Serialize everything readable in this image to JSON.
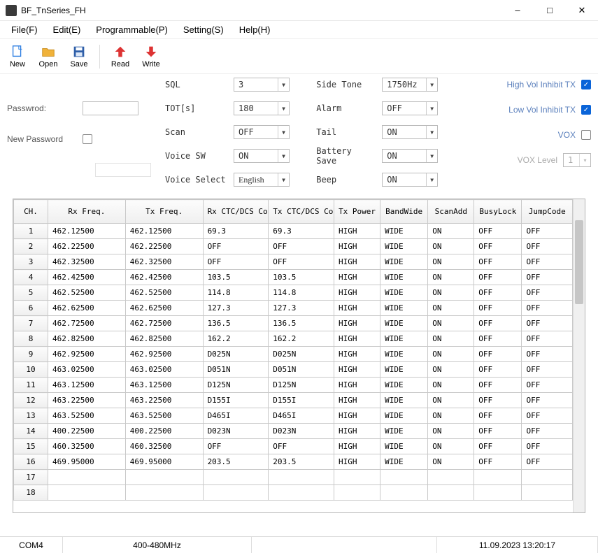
{
  "window": {
    "title": "BF_TnSeries_FH"
  },
  "menu": {
    "file": "File(F)",
    "edit": "Edit(E)",
    "programmable": "Programmable(P)",
    "setting": "Setting(S)",
    "help": "Help(H)"
  },
  "toolbar": {
    "new": "New",
    "open": "Open",
    "save": "Save",
    "read": "Read",
    "write": "Write"
  },
  "password": {
    "label_current": "Passwrod:",
    "label_new": "New Password",
    "value_current": "",
    "value_new": "",
    "new_checked": false
  },
  "settings_a": {
    "sql": {
      "label": "SQL",
      "value": "3"
    },
    "tot": {
      "label": "TOT[s]",
      "value": "180"
    },
    "scan": {
      "label": "Scan",
      "value": "OFF"
    },
    "voice_sw": {
      "label": "Voice SW",
      "value": "ON"
    },
    "voice_select": {
      "label": "Voice Select",
      "value": "English"
    }
  },
  "settings_b": {
    "side_tone": {
      "label": "Side Tone",
      "value": "1750Hz"
    },
    "alarm": {
      "label": "Alarm",
      "value": "OFF"
    },
    "tail": {
      "label": "Tail",
      "value": "ON"
    },
    "battery_save": {
      "label": "Battery Save",
      "value": "ON"
    },
    "beep": {
      "label": "Beep",
      "value": "ON"
    }
  },
  "settings_c": {
    "high_vol": {
      "label": "High Vol Inhibit TX",
      "checked": true
    },
    "low_vol": {
      "label": "Low Vol Inhibit TX",
      "checked": true
    },
    "vox": {
      "label": "VOX",
      "checked": false
    },
    "vox_level": {
      "label": "VOX Level",
      "value": "1"
    }
  },
  "table": {
    "headers": {
      "ch": "CH.",
      "rx_freq": "Rx Freq.",
      "tx_freq": "Tx Freq.",
      "rx_code": "Rx CTC/DCS Code",
      "tx_code": "Tx CTC/DCS Code",
      "tx_power": "Tx Power",
      "bandwide": "BandWide",
      "scanadd": "ScanAdd",
      "busylock": "BusyLock",
      "jumpcode": "JumpCode"
    },
    "rows": [
      {
        "ch": "1",
        "rx": "462.12500",
        "tx": "462.12500",
        "rxc": "69.3",
        "txc": "69.3",
        "pow": "HIGH",
        "bw": "WIDE",
        "scan": "ON",
        "busy": "OFF",
        "jump": "OFF"
      },
      {
        "ch": "2",
        "rx": "462.22500",
        "tx": "462.22500",
        "rxc": "OFF",
        "txc": "OFF",
        "pow": "HIGH",
        "bw": "WIDE",
        "scan": "ON",
        "busy": "OFF",
        "jump": "OFF"
      },
      {
        "ch": "3",
        "rx": "462.32500",
        "tx": "462.32500",
        "rxc": "OFF",
        "txc": "OFF",
        "pow": "HIGH",
        "bw": "WIDE",
        "scan": "ON",
        "busy": "OFF",
        "jump": "OFF"
      },
      {
        "ch": "4",
        "rx": "462.42500",
        "tx": "462.42500",
        "rxc": "103.5",
        "txc": "103.5",
        "pow": "HIGH",
        "bw": "WIDE",
        "scan": "ON",
        "busy": "OFF",
        "jump": "OFF"
      },
      {
        "ch": "5",
        "rx": "462.52500",
        "tx": "462.52500",
        "rxc": "114.8",
        "txc": "114.8",
        "pow": "HIGH",
        "bw": "WIDE",
        "scan": "ON",
        "busy": "OFF",
        "jump": "OFF"
      },
      {
        "ch": "6",
        "rx": "462.62500",
        "tx": "462.62500",
        "rxc": "127.3",
        "txc": "127.3",
        "pow": "HIGH",
        "bw": "WIDE",
        "scan": "ON",
        "busy": "OFF",
        "jump": "OFF"
      },
      {
        "ch": "7",
        "rx": "462.72500",
        "tx": "462.72500",
        "rxc": "136.5",
        "txc": "136.5",
        "pow": "HIGH",
        "bw": "WIDE",
        "scan": "ON",
        "busy": "OFF",
        "jump": "OFF"
      },
      {
        "ch": "8",
        "rx": "462.82500",
        "tx": "462.82500",
        "rxc": "162.2",
        "txc": "162.2",
        "pow": "HIGH",
        "bw": "WIDE",
        "scan": "ON",
        "busy": "OFF",
        "jump": "OFF"
      },
      {
        "ch": "9",
        "rx": "462.92500",
        "tx": "462.92500",
        "rxc": "D025N",
        "txc": "D025N",
        "pow": "HIGH",
        "bw": "WIDE",
        "scan": "ON",
        "busy": "OFF",
        "jump": "OFF"
      },
      {
        "ch": "10",
        "rx": "463.02500",
        "tx": "463.02500",
        "rxc": "D051N",
        "txc": "D051N",
        "pow": "HIGH",
        "bw": "WIDE",
        "scan": "ON",
        "busy": "OFF",
        "jump": "OFF"
      },
      {
        "ch": "11",
        "rx": "463.12500",
        "tx": "463.12500",
        "rxc": "D125N",
        "txc": "D125N",
        "pow": "HIGH",
        "bw": "WIDE",
        "scan": "ON",
        "busy": "OFF",
        "jump": "OFF"
      },
      {
        "ch": "12",
        "rx": "463.22500",
        "tx": "463.22500",
        "rxc": "D155I",
        "txc": "D155I",
        "pow": "HIGH",
        "bw": "WIDE",
        "scan": "ON",
        "busy": "OFF",
        "jump": "OFF"
      },
      {
        "ch": "13",
        "rx": "463.52500",
        "tx": "463.52500",
        "rxc": "D465I",
        "txc": "D465I",
        "pow": "HIGH",
        "bw": "WIDE",
        "scan": "ON",
        "busy": "OFF",
        "jump": "OFF"
      },
      {
        "ch": "14",
        "rx": "400.22500",
        "tx": "400.22500",
        "rxc": "D023N",
        "txc": "D023N",
        "pow": "HIGH",
        "bw": "WIDE",
        "scan": "ON",
        "busy": "OFF",
        "jump": "OFF"
      },
      {
        "ch": "15",
        "rx": "460.32500",
        "tx": "460.32500",
        "rxc": "OFF",
        "txc": "OFF",
        "pow": "HIGH",
        "bw": "WIDE",
        "scan": "ON",
        "busy": "OFF",
        "jump": "OFF"
      },
      {
        "ch": "16",
        "rx": "469.95000",
        "tx": "469.95000",
        "rxc": "203.5",
        "txc": "203.5",
        "pow": "HIGH",
        "bw": "WIDE",
        "scan": "ON",
        "busy": "OFF",
        "jump": "OFF"
      },
      {
        "ch": "17",
        "rx": "",
        "tx": "",
        "rxc": "",
        "txc": "",
        "pow": "",
        "bw": "",
        "scan": "",
        "busy": "",
        "jump": ""
      },
      {
        "ch": "18",
        "rx": "",
        "tx": "",
        "rxc": "",
        "txc": "",
        "pow": "",
        "bw": "",
        "scan": "",
        "busy": "",
        "jump": ""
      }
    ]
  },
  "status": {
    "port": "COM4",
    "range": "400-480MHz",
    "datetime": "11.09.2023 13:20:17"
  }
}
